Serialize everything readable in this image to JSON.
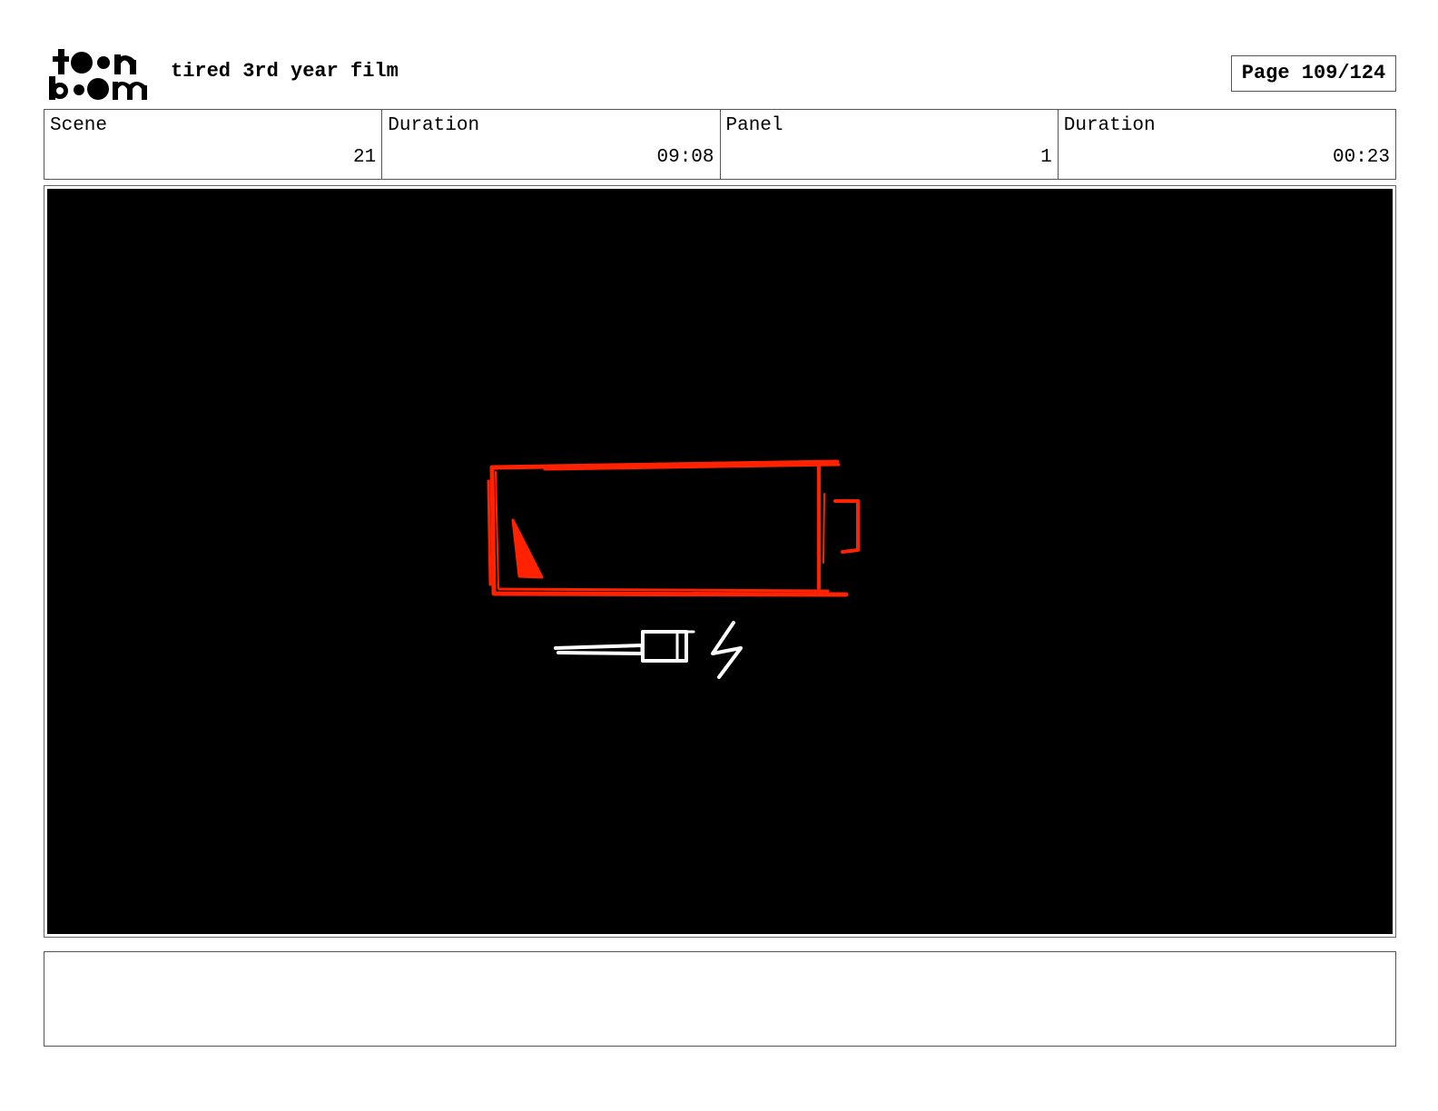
{
  "header": {
    "logo_text": "toon boom",
    "project_title": "tired 3rd year film",
    "page_label": "Page 109/124"
  },
  "info": [
    {
      "label": "Scene",
      "value": "21"
    },
    {
      "label": "Duration",
      "value": "09:08"
    },
    {
      "label": "Panel",
      "value": "1"
    },
    {
      "label": "Duration",
      "value": "00:23"
    }
  ],
  "panel": {
    "background_color": "#000000",
    "drawing_color_primary": "#ff2200",
    "drawing_color_secondary": "#ffffff",
    "content_icons": [
      "battery-low-icon",
      "charging-plug-icon",
      "lightning-bolt-icon"
    ]
  },
  "notes": {
    "text": ""
  }
}
